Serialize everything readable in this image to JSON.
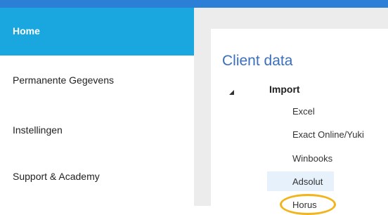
{
  "sidebar": {
    "items": [
      {
        "label": "Home",
        "active": true
      },
      {
        "label": "Permanente Gegevens",
        "active": false
      },
      {
        "label": "Instellingen",
        "active": false
      },
      {
        "label": "Support & Academy",
        "active": false
      }
    ]
  },
  "main": {
    "title": "Client data",
    "tree": {
      "root_label": "Import",
      "expanded": true,
      "toggle_icon": "caret-down-left-icon",
      "children": [
        {
          "label": "Excel",
          "selected": false
        },
        {
          "label": "Exact Online/Yuki",
          "selected": false
        },
        {
          "label": "Winbooks",
          "selected": false
        },
        {
          "label": "Adsolut",
          "selected": true
        },
        {
          "label": "Horus",
          "selected": false
        }
      ]
    }
  },
  "colors": {
    "accent_top_bar": "#2c7fd6",
    "active_nav": "#1aa7e0",
    "title_blue": "#3a6fbf",
    "selected_row": "#e6f1fb",
    "highlight_ring": "#f2b41b",
    "content_background": "#ececec"
  }
}
